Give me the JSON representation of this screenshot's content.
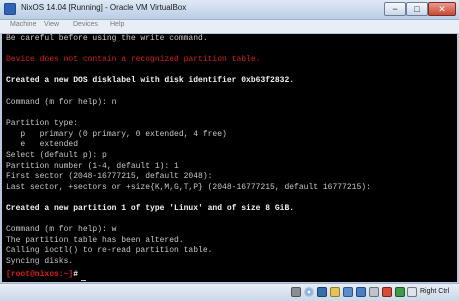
{
  "window": {
    "title": "NixOS 14.04 [Running] - Oracle VM VirtualBox",
    "minimize_glyph": "−",
    "maximize_glyph": "□",
    "close_glyph": "✕"
  },
  "menu": {
    "machine": "Machine",
    "view": "View",
    "devices": "Devices",
    "help": "Help"
  },
  "terminal": {
    "lines": [
      "Be careful before using the write command.",
      "Device does not contain a recognized partition table.",
      "Created a new DOS disklabel with disk identifier 0xb63f2832.",
      "Command (m for help): n",
      "Partition type:",
      "   p   primary (0 primary, 0 extended, 4 free)",
      "   e   extended",
      "Select (default p): p",
      "Partition number (1-4, default 1): 1",
      "First sector (2048-16777215, default 2048):",
      "Last sector, +sectors or +size{K,M,G,T,P} (2048-16777215, default 16777215):",
      "Created a new partition 1 of type 'Linux' and of size 8 GiB.",
      "Command (m for help): w",
      "The partition table has been altered.",
      "Calling ioctl() to re-read partition table.",
      "Syncing disks."
    ],
    "prompt_user": "[root@nixos:~]",
    "prompt_hash": "#"
  },
  "statusbar": {
    "host_key": "Right Ctrl",
    "icons": [
      "hard-disk",
      "optical-drive",
      "usb",
      "shared-folders",
      "network",
      "display",
      "video-capture",
      "mouse-integration",
      "cpu",
      "keyboard"
    ]
  },
  "colors": {
    "terminal_bg": "#000000",
    "error_red": "#d81e1e",
    "text": "#c7c7c7"
  }
}
